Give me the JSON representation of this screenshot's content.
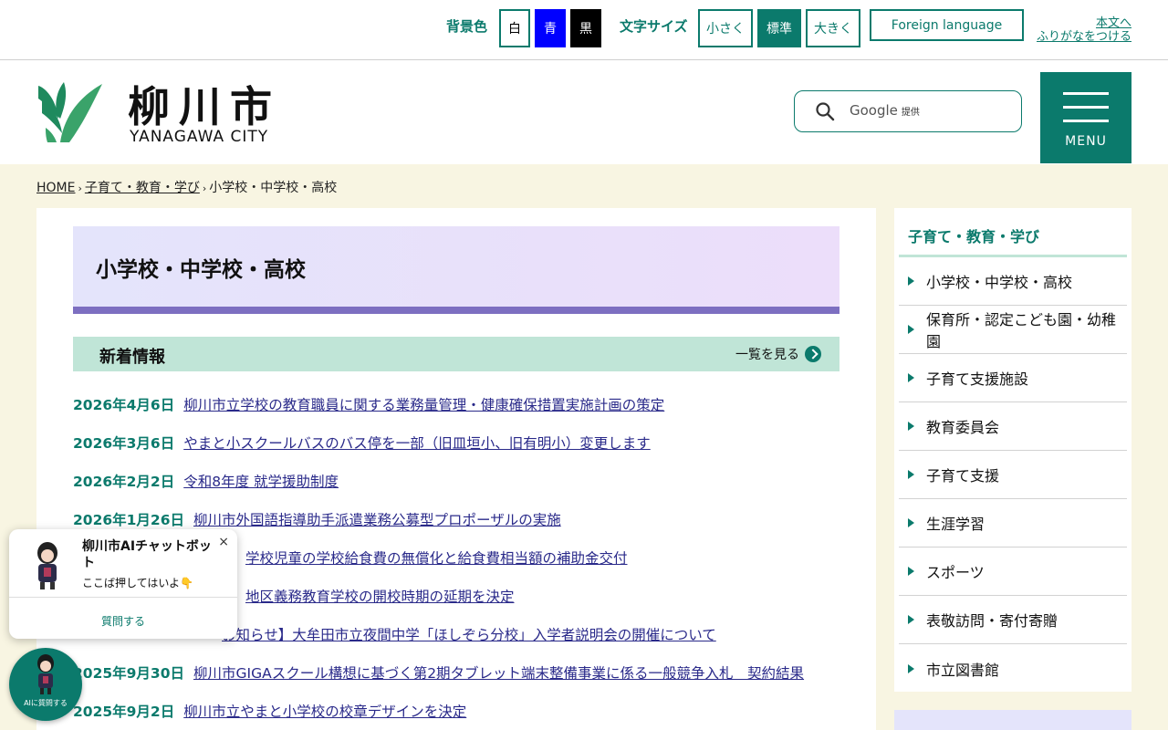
{
  "topbar": {
    "bg_label": "背景色",
    "bg_white": "白",
    "bg_blue": "青",
    "bg_black": "黒",
    "size_label": "文字サイズ",
    "size_small": "小さく",
    "size_standard": "標準",
    "size_large": "大きく",
    "foreign": "Foreign language",
    "furigana_line1": "本文へ",
    "furigana_line2": "ふりがなをつける"
  },
  "header": {
    "logo_text": "柳川市",
    "logo_sub": "YANAGAWA CITY",
    "search_placeholder": "Google",
    "search_provider": "提供",
    "menu_label": "MENU"
  },
  "breadcrumb": {
    "home": "HOME",
    "level1": "子育て・教育・学び",
    "current": "小学校・中学校・高校"
  },
  "page_title": "小学校・中学校・高校",
  "news": {
    "heading": "新着情報",
    "more_label": "一覧を見る",
    "items": [
      {
        "date": "2026年4月6日",
        "title": "柳川市立学校の教育職員に関する業務量管理・健康確保措置実施計画の策定"
      },
      {
        "date": "2026年3月6日",
        "title": "やまと小スクールバスのバス停を一部（旧皿垣小、旧有明小）変更します"
      },
      {
        "date": "2026年2月2日",
        "title": "令和8年度 就学援助制度"
      },
      {
        "date": "2026年1月26日",
        "title": "柳川市外国語指導助手派遣業務公募型プロポーザルの実施"
      },
      {
        "date": "",
        "title": "学校児童の学校給食費の無償化と給食費相当額の補助金交付"
      },
      {
        "date": "",
        "title": "地区義務教育学校の開校時期の延期を決定"
      },
      {
        "date": "",
        "title": "お知らせ】大牟田市立夜間中学「ほしぞら分校」入学者説明会の開催について"
      },
      {
        "date": "2025年9月30日",
        "title": "柳川市GIGAスクール構想に基づく第2期タブレット端末整備事業に係る一般競争入札　契約結果"
      },
      {
        "date": "2025年9月2日",
        "title": "柳川市立やまと小学校の校章デザインを決定"
      }
    ]
  },
  "sidebar": {
    "heading": "子育て・教育・学び",
    "items": [
      {
        "label": "小学校・中学校・高校"
      },
      {
        "label": "保育所・認定こども園・幼稚園"
      },
      {
        "label": "子育て支援施設"
      },
      {
        "label": "教育委員会"
      },
      {
        "label": "子育て支援"
      },
      {
        "label": "生涯学習"
      },
      {
        "label": "スポーツ"
      },
      {
        "label": "表敬訪問・寄付寄贈"
      },
      {
        "label": "市立図書館"
      }
    ]
  },
  "chat": {
    "title": "柳川市AIチャットボット",
    "close": "×",
    "text": "ここば押してはいよ👇",
    "ask": "質問する",
    "fab_label": "AIに質問する"
  },
  "colors": {
    "accent": "#0b7a6c",
    "title_band": "#7d6fc1",
    "news_band": "#c0e5d7",
    "body_bg": "#f8f5e2"
  }
}
